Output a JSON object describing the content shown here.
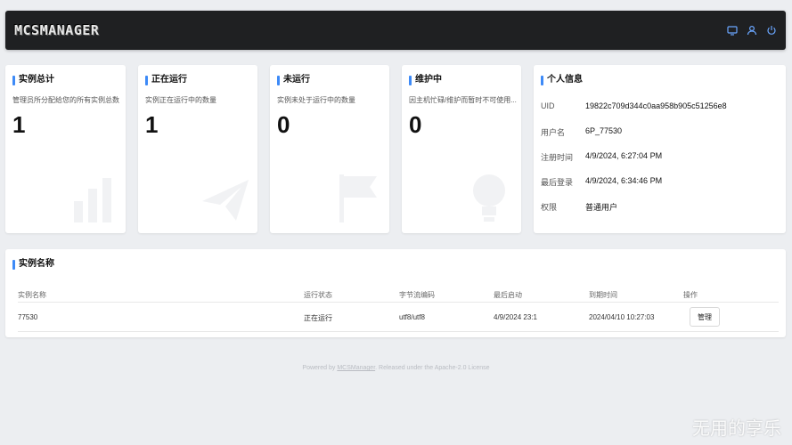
{
  "header": {
    "logo_text": "MCSMANAGER",
    "icons": [
      "dashboard-icon",
      "user-icon",
      "power-icon"
    ],
    "accent": "#3d8af7"
  },
  "stats": [
    {
      "title": "实例总计",
      "desc": "管理员所分配给您的所有实例总数",
      "value": "1",
      "icon": "bar-chart-icon"
    },
    {
      "title": "正在运行",
      "desc": "实例正在运行中的数量",
      "value": "1",
      "icon": "paper-plane-icon"
    },
    {
      "title": "未运行",
      "desc": "实例未处于运行中的数量",
      "value": "0",
      "icon": "flag-icon"
    },
    {
      "title": "维护中",
      "desc": "因主机忙碌/维护而暂时不可使用...",
      "value": "0",
      "icon": "lightbulb-icon"
    }
  ],
  "profile": {
    "title": "个人信息",
    "rows": [
      {
        "key": "UID",
        "value": "19822c709d344c0aa958b905c51256e8"
      },
      {
        "key": "用户名",
        "value": "6P_77530"
      },
      {
        "key": "注册时间",
        "value": "4/9/2024, 6:27:04 PM"
      },
      {
        "key": "最后登录",
        "value": "4/9/2024, 6:34:46 PM"
      },
      {
        "key": "权限",
        "value": "普通用户"
      }
    ]
  },
  "instances": {
    "title": "实例名称",
    "columns": [
      "实例名称",
      "运行状态",
      "字节流编码",
      "最后启动",
      "到期时间",
      "操作"
    ],
    "rows": [
      {
        "name": "77530",
        "status": "正在运行",
        "encoding": "utf8/utf8",
        "last_start": "4/9/2024 23:1",
        "expire": "2024/04/10 10:27:03",
        "action": "管理"
      }
    ]
  },
  "footer": {
    "prefix": "Powered by ",
    "link": "MCSManager",
    "suffix": ". Released under the Apache-2.0 License"
  },
  "watermark": "无用的享乐"
}
